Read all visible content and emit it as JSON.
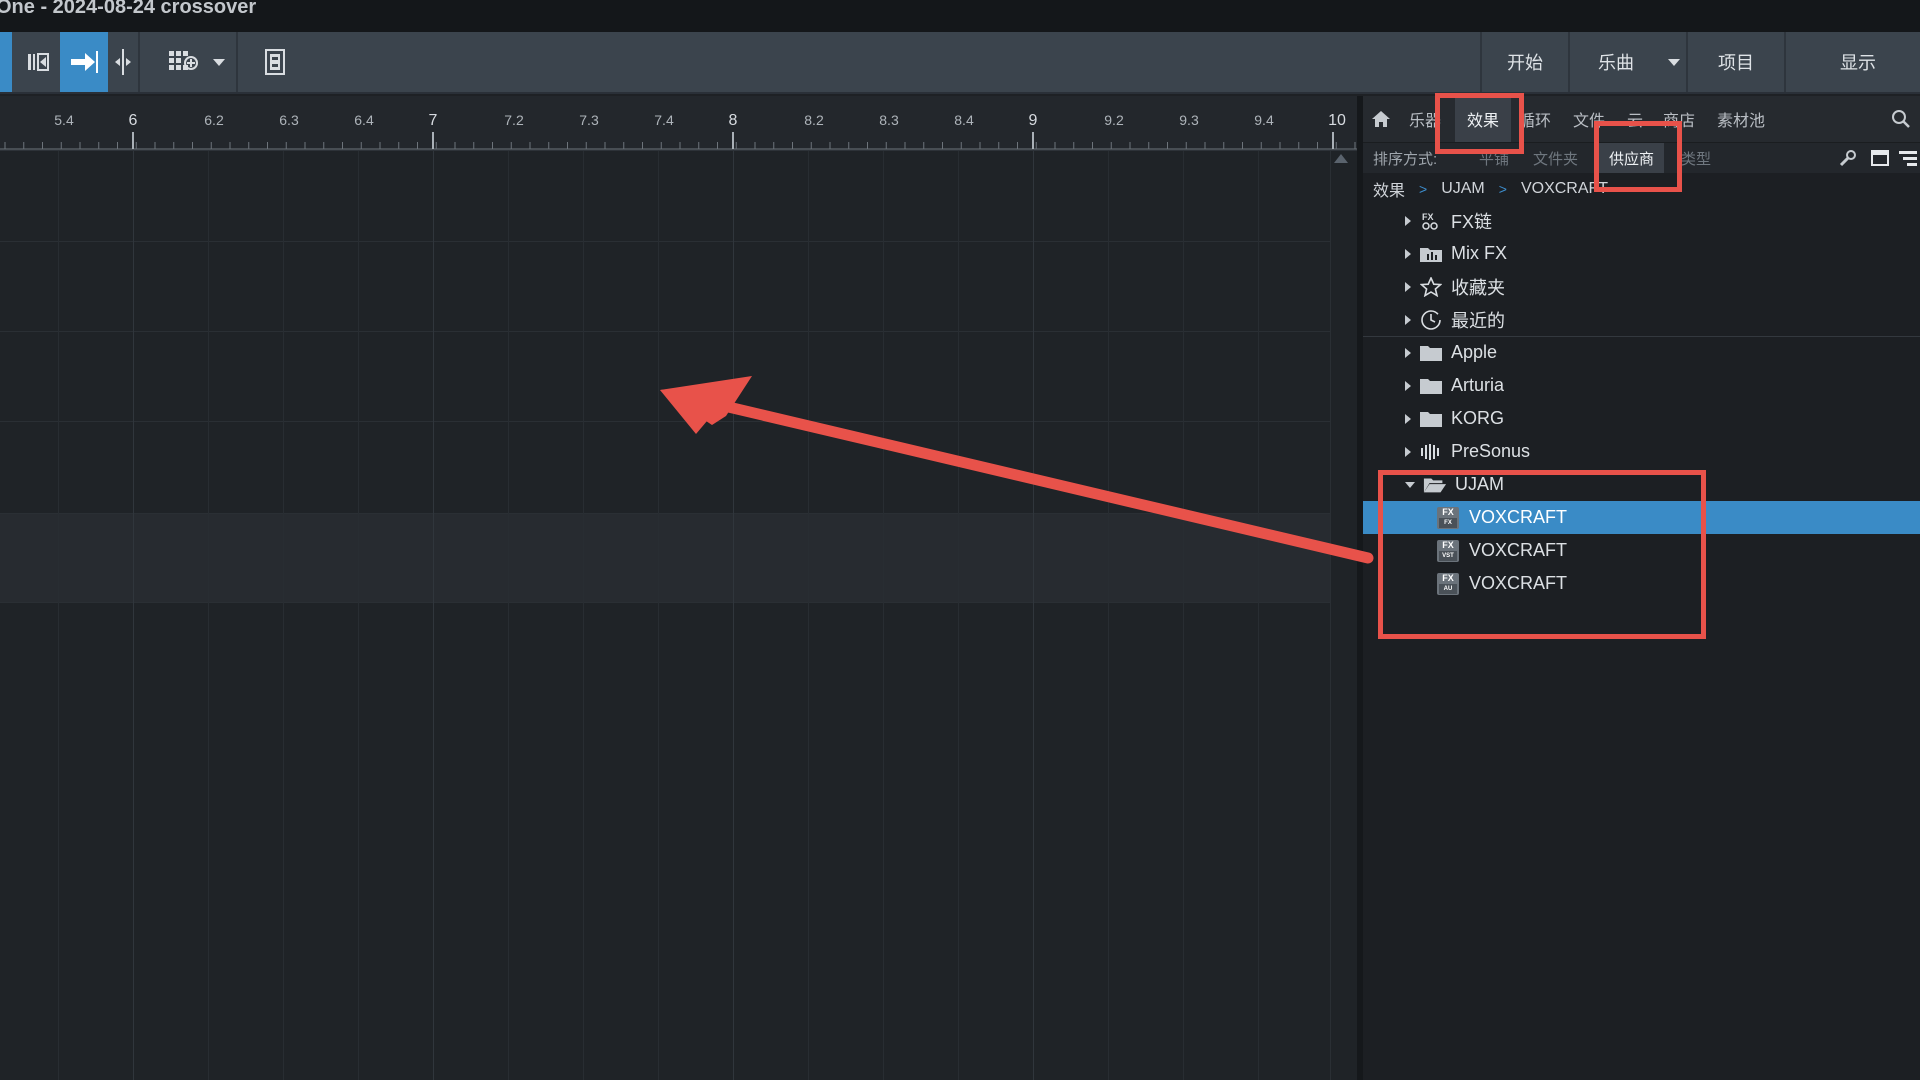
{
  "window": {
    "title": "One - 2024-08-24 crossover"
  },
  "toolbar": {
    "menu": [
      {
        "label": "开始"
      },
      {
        "label": "乐曲"
      },
      {
        "label": "项目"
      },
      {
        "label": "显示"
      }
    ]
  },
  "ruler": {
    "labels": [
      "5.4",
      "6",
      "6.2",
      "6.3",
      "6.4",
      "7",
      "7.2",
      "7.3",
      "7.4",
      "8",
      "8.2",
      "8.3",
      "8.4",
      "9",
      "9.2",
      "9.3",
      "9.4",
      "10"
    ]
  },
  "browser": {
    "tabs": {
      "instruments": "乐器",
      "effects": "效果",
      "loops": "循环",
      "files": "文件",
      "cloud": "云",
      "shop": "商店",
      "pool": "素材池"
    },
    "sort": {
      "label": "排序方式:",
      "flat": "平铺",
      "folder": "文件夹",
      "vendor": "供应商",
      "type": "类型"
    },
    "breadcrumb": {
      "root": "效果",
      "vendor": "UJAM",
      "plugin": "VOXCRAFT"
    },
    "tree": {
      "fx_chains": "FX链",
      "mix_fx": "Mix FX",
      "favorites": "收藏夹",
      "recent": "最近的",
      "apple": "Apple",
      "arturia": "Arturia",
      "korg": "KORG",
      "presonus": "PreSonus",
      "ujam": "UJAM",
      "vox1": {
        "label": "VOXCRAFT",
        "format": "FX"
      },
      "vox2": {
        "label": "VOXCRAFT",
        "format": "VST"
      },
      "vox3": {
        "label": "VOXCRAFT",
        "format": "AU"
      }
    }
  },
  "annotation_color": "#e8524a",
  "selection_color": "#3a8bc6"
}
